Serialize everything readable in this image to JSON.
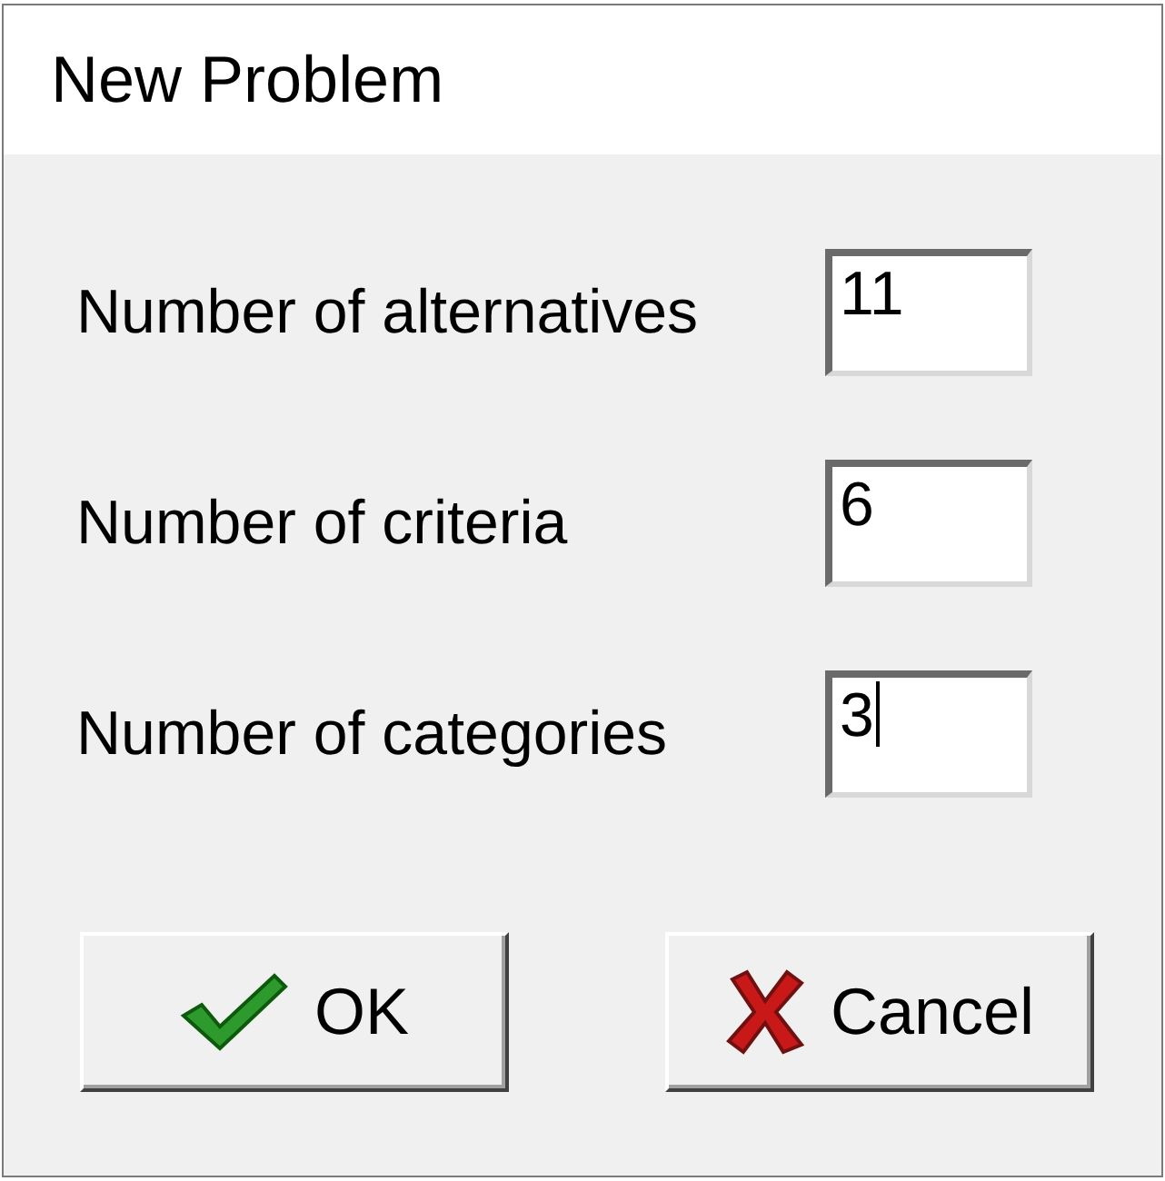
{
  "window": {
    "title": "New Problem"
  },
  "fields": [
    {
      "label": "Number of alternatives",
      "value": "11",
      "focused": false
    },
    {
      "label": "Number of criteria",
      "value": "6",
      "focused": false
    },
    {
      "label": "Number of categories",
      "value": "3",
      "focused": true
    }
  ],
  "buttons": [
    {
      "label": "OK",
      "kind": "ok"
    },
    {
      "label": "Cancel",
      "kind": "cancel"
    }
  ]
}
